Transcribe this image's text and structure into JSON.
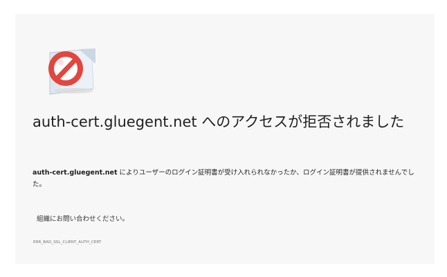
{
  "error_page": {
    "icon": "blocked-certificate-icon",
    "title": "auth-cert.gluegent.net へのアクセスが拒否されました",
    "message_host": "auth-cert.gluegent.net",
    "message_text": " によりユーザーのログイン証明書が受け入れられなかったか、ログイン証明書が提供されませんでした。",
    "contact_text": "組織にお問い合わせください。",
    "error_code": "ERR_BAD_SSL_CLIENT_AUTH_CERT"
  },
  "colors": {
    "background": "#f7f7f7",
    "text": "#202020",
    "blocked_red": "#e2463f"
  }
}
